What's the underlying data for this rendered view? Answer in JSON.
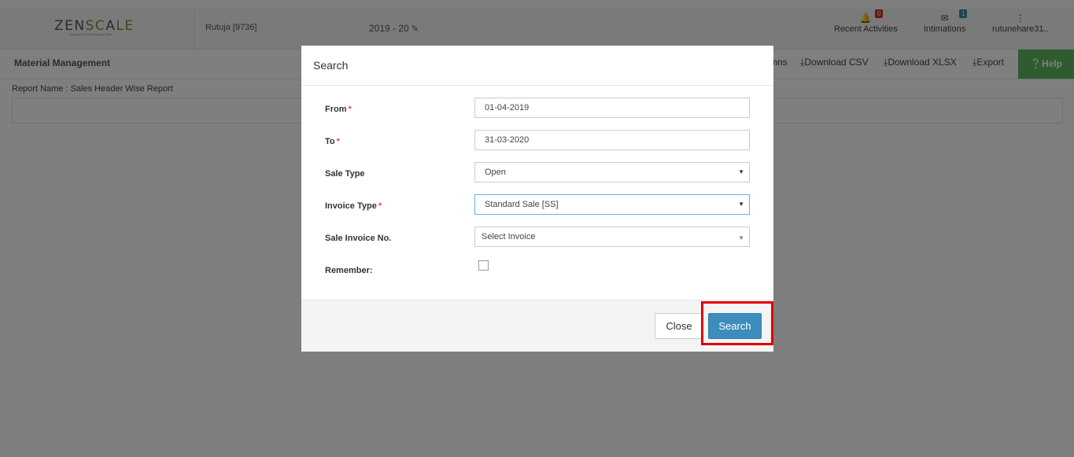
{
  "header": {
    "logo_left": "ZEN",
    "logo_accent": "SC",
    "logo_mid": "A",
    "logo_right": "LE",
    "logo_tagline": "Business Goes Business Plans",
    "user_company": "Rutuja [9736]",
    "financial_year": "2019 - 20",
    "recent_activities": {
      "label": "Recent Activities",
      "count": "0"
    },
    "intimations": {
      "label": "Intimations",
      "count": "1"
    },
    "user_menu": {
      "label": "rutunehare31.."
    }
  },
  "subbar": {
    "module": "Material Management",
    "columns_fragment": "mns",
    "download_csv": "Download CSV",
    "download_xlsx": "Download XLSX",
    "export": "Export",
    "help": "Help"
  },
  "report": {
    "name": "Report Name : Sales Header Wise Report"
  },
  "modal": {
    "title": "Search",
    "fields": {
      "from": {
        "label": "From",
        "value": "01-04-2019"
      },
      "to": {
        "label": "To",
        "value": "31-03-2020"
      },
      "sale_type": {
        "label": "Sale Type",
        "value": "Open"
      },
      "invoice_type": {
        "label": "Invoice Type",
        "value": "Standard Sale [SS]"
      },
      "sale_invoice_no": {
        "label": "Sale Invoice No.",
        "value": "Select Invoice"
      },
      "remember": {
        "label": "Remember:"
      }
    },
    "required_marker": "*",
    "close_label": "Close",
    "search_label": "Search"
  },
  "colors": {
    "primary": "#3c8dbc",
    "help_green": "#5cb85c",
    "highlight": "#e00000",
    "required": "#d9534f"
  }
}
